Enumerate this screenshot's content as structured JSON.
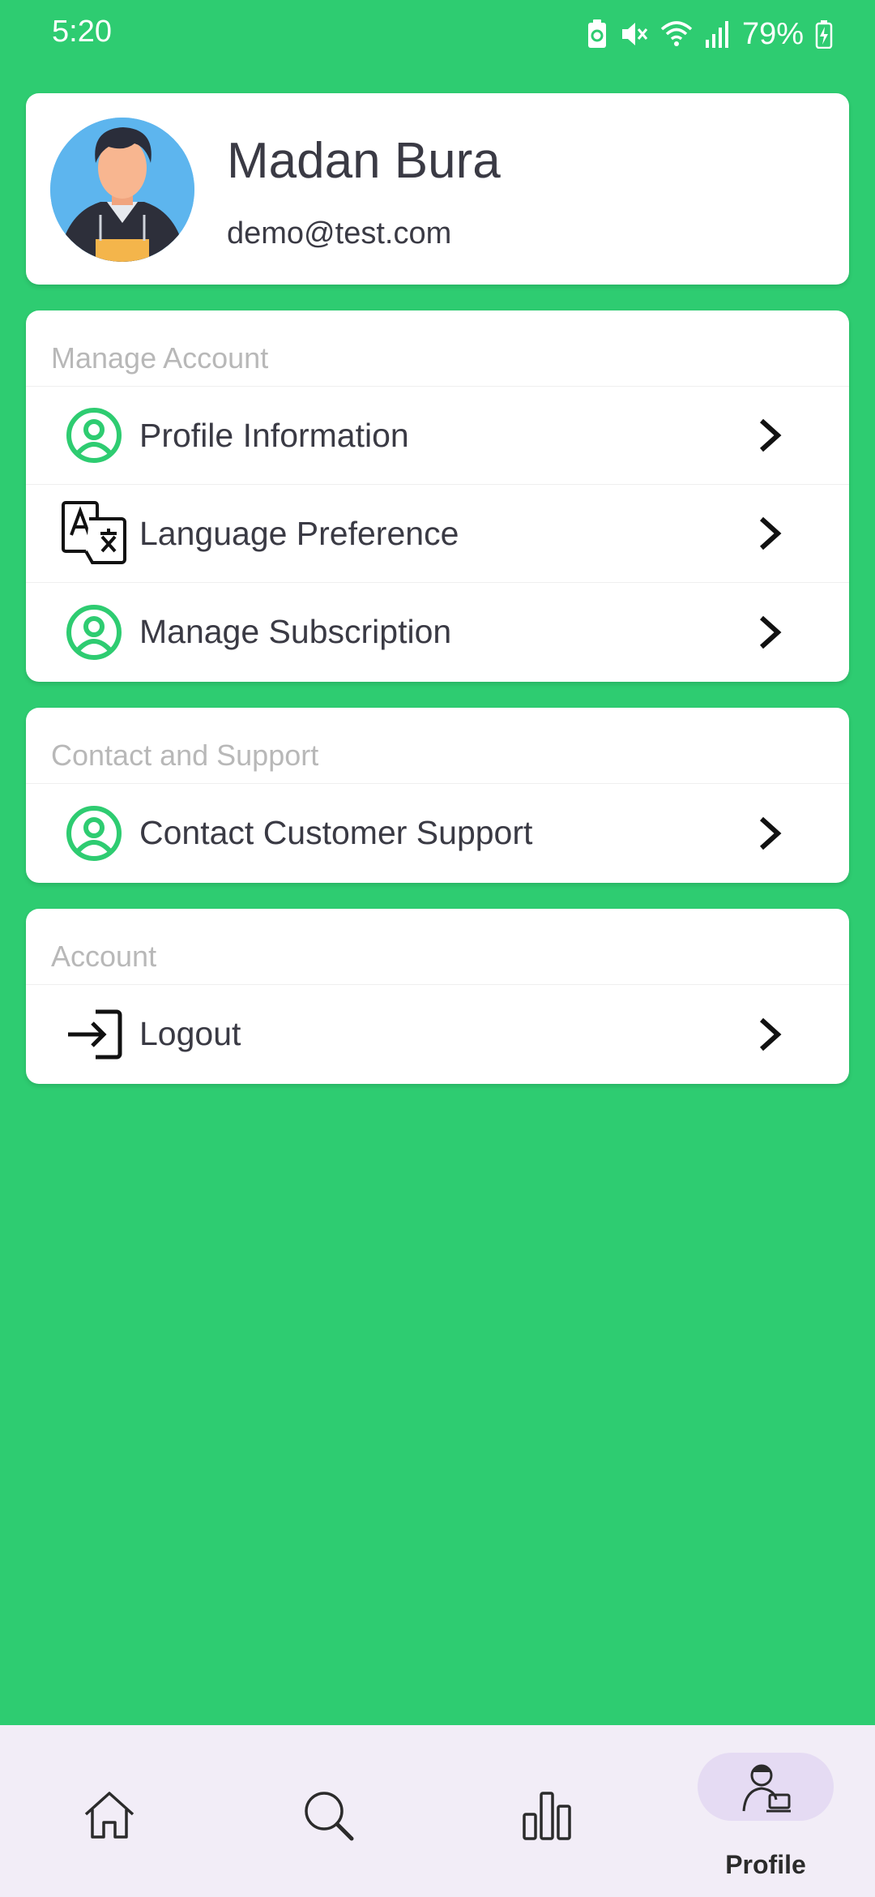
{
  "status_bar": {
    "time": "5:20",
    "battery_percent": "79%",
    "icons": [
      "battery-saver-icon",
      "vibrate-mute-icon",
      "wifi-icon",
      "signal-icon",
      "battery-charging-icon"
    ]
  },
  "profile": {
    "name": "Madan Bura",
    "email": "demo@test.com",
    "avatar_icon": "avatar-illustration"
  },
  "sections": {
    "manage_account": {
      "title": "Manage Account",
      "items": [
        {
          "label": "Profile Information",
          "icon": "user-circle-icon"
        },
        {
          "label": "Language Preference",
          "icon": "translate-icon"
        },
        {
          "label": "Manage Subscription",
          "icon": "user-circle-icon"
        }
      ]
    },
    "contact_support": {
      "title": "Contact and Support",
      "items": [
        {
          "label": "Contact Customer Support",
          "icon": "user-circle-icon"
        }
      ]
    },
    "account": {
      "title": "Account",
      "items": [
        {
          "label": "Logout",
          "icon": "logout-icon"
        }
      ]
    }
  },
  "bottom_nav": {
    "items": [
      {
        "icon": "home-icon",
        "label": ""
      },
      {
        "icon": "search-icon",
        "label": ""
      },
      {
        "icon": "bar-chart-icon",
        "label": ""
      },
      {
        "icon": "profile-icon",
        "label": "Profile",
        "active": true
      }
    ]
  },
  "colors": {
    "background": "#2ECC71",
    "accent_icon": "#2ECC71",
    "nav_background": "#F2EDF7",
    "nav_active_pill": "#E5DBF3",
    "text_primary": "#3A3A44",
    "section_title": "#B8B8B8"
  }
}
